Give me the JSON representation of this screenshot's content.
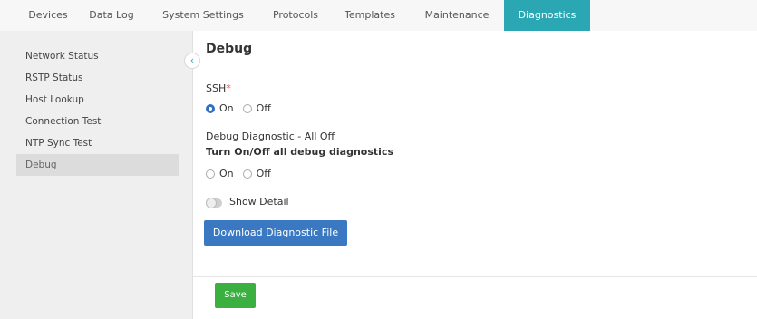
{
  "tabs": [
    {
      "label": "Devices"
    },
    {
      "label": "Data Log"
    },
    {
      "label": "System Settings"
    },
    {
      "label": "Protocols"
    },
    {
      "label": "Templates"
    },
    {
      "label": "Maintenance"
    },
    {
      "label": "Diagnostics"
    }
  ],
  "sidebar": {
    "items": [
      {
        "label": "Network Status"
      },
      {
        "label": "RSTP Status"
      },
      {
        "label": "Host Lookup"
      },
      {
        "label": "Connection Test"
      },
      {
        "label": "NTP Sync Test"
      },
      {
        "label": "Debug"
      }
    ]
  },
  "main": {
    "title": "Debug",
    "ssh": {
      "label": "SSH",
      "required_mark": "*",
      "on_label": "On",
      "off_label": "Off",
      "selected": "On"
    },
    "debug_diag": {
      "status": "Debug Diagnostic - All Off",
      "heading": "Turn On/Off all debug diagnostics",
      "on_label": "On",
      "off_label": "Off",
      "selected": "none"
    },
    "show_detail_label": "Show Detail",
    "download_label": "Download Diagnostic File",
    "save_label": "Save"
  },
  "colors": {
    "accent": "#2aa7b3",
    "primary_button": "#3a78c2",
    "save_button": "#3bb041",
    "required": "#d9534f"
  },
  "icons": {
    "collapse": "chevron-left-icon"
  }
}
